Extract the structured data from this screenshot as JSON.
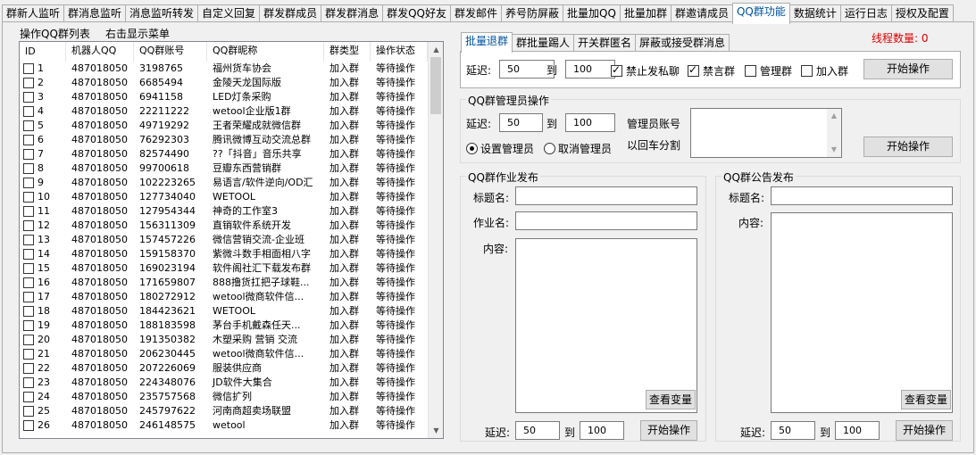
{
  "top_tabs": [
    "群新人监听",
    "群消息监听",
    "消息监听转发",
    "自定义回复",
    "群发群成员",
    "群发群消息",
    "群发QQ好友",
    "群发邮件",
    "养号防屏蔽",
    "批量加QQ",
    "批量加群",
    "群邀请成员",
    "QQ群功能",
    "数据统计",
    "运行日志",
    "授权及配置"
  ],
  "left": {
    "list_label": "操作QQ群列表",
    "menu_label": "右击显示菜单",
    "columns": [
      "ID",
      "机器人QQ",
      "QQ群账号",
      "QQ群昵称",
      "群类型",
      "操作状态"
    ],
    "rows": [
      [
        "1",
        "487018050",
        "3198765",
        "福州货车协会",
        "加入群",
        "等待操作"
      ],
      [
        "2",
        "487018050",
        "6685494",
        "金陵天龙国际版",
        "加入群",
        "等待操作"
      ],
      [
        "3",
        "487018050",
        "6941158",
        "LED灯条采购",
        "加入群",
        "等待操作"
      ],
      [
        "4",
        "487018050",
        "22211222",
        "wetool企业版1群",
        "加入群",
        "等待操作"
      ],
      [
        "5",
        "487018050",
        "49719292",
        "王者荣耀成就微信群",
        "加入群",
        "等待操作"
      ],
      [
        "6",
        "487018050",
        "76292303",
        "腾讯微博互动交流总群",
        "加入群",
        "等待操作"
      ],
      [
        "7",
        "487018050",
        "82574490",
        "??「抖音」音乐共享",
        "加入群",
        "等待操作"
      ],
      [
        "8",
        "487018050",
        "99700618",
        "豆瓣东西营销群",
        "加入群",
        "等待操作"
      ],
      [
        "9",
        "487018050",
        "102223265",
        "易语言/软件逆向/OD汇",
        "加入群",
        "等待操作"
      ],
      [
        "10",
        "487018050",
        "127734040",
        "WETOOL",
        "加入群",
        "等待操作"
      ],
      [
        "11",
        "487018050",
        "127954344",
        "神奇的工作室3",
        "加入群",
        "等待操作"
      ],
      [
        "12",
        "487018050",
        "156311309",
        "直销软件系统开发",
        "加入群",
        "等待操作"
      ],
      [
        "13",
        "487018050",
        "157457226",
        "微信营销交流-企业班",
        "加入群",
        "等待操作"
      ],
      [
        "14",
        "487018050",
        "159158370",
        "紫微斗数手相面相八字",
        "加入群",
        "等待操作"
      ],
      [
        "15",
        "487018050",
        "169023194",
        "软件阁社汇下载发布群",
        "加入群",
        "等待操作"
      ],
      [
        "16",
        "487018050",
        "171659807",
        "888撸货扛把子球鞋...",
        "加入群",
        "等待操作"
      ],
      [
        "17",
        "487018050",
        "180272912",
        "wetool微商软件信...",
        "加入群",
        "等待操作"
      ],
      [
        "18",
        "487018050",
        "184423621",
        "WETOOL",
        "加入群",
        "等待操作"
      ],
      [
        "19",
        "487018050",
        "188183598",
        "茅台手机戴森任天...",
        "加入群",
        "等待操作"
      ],
      [
        "20",
        "487018050",
        "191350382",
        "木塑采购 营销 交流",
        "加入群",
        "等待操作"
      ],
      [
        "21",
        "487018050",
        "206230445",
        "wetool微商软件信...",
        "加入群",
        "等待操作"
      ],
      [
        "22",
        "487018050",
        "207226069",
        "服装供应商",
        "加入群",
        "等待操作"
      ],
      [
        "23",
        "487018050",
        "224348076",
        "JD软件大集合",
        "加入群",
        "等待操作"
      ],
      [
        "24",
        "487018050",
        "235757568",
        "微信扩列",
        "加入群",
        "等待操作"
      ],
      [
        "25",
        "487018050",
        "245797622",
        "河南商超卖场联盟",
        "加入群",
        "等待操作"
      ],
      [
        "26",
        "487018050",
        "246148575",
        "wetool",
        "加入群",
        "等待操作"
      ]
    ]
  },
  "thread_count_label": "线程数量: 0",
  "sub_tabs": [
    "批量退群",
    "群批量踢人",
    "开关群匿名",
    "屏蔽或接受群消息"
  ],
  "batch_quit": {
    "delay_label": "延迟:",
    "delay_min": "50",
    "to_label": "到",
    "delay_max": "100",
    "chk_no_private": "禁止发私聊",
    "chk_mute": "禁言群",
    "chk_manage": "管理群",
    "chk_join": "加入群",
    "start_label": "开始操作"
  },
  "admin": {
    "title": "QQ群管理员操作",
    "delay_label": "延迟:",
    "delay_min": "50",
    "to_label": "到",
    "delay_max": "100",
    "account_label": "管理员账号",
    "split_label": "以回车分割",
    "radio_set": "设置管理员",
    "radio_cancel": "取消管理员",
    "start_label": "开始操作"
  },
  "homework": {
    "title": "QQ群作业发布",
    "title_label": "标题名:",
    "name_label": "作业名:",
    "content_label": "内容:",
    "vars_label": "查看变量",
    "delay_label": "延迟:",
    "delay_min": "50",
    "to_label": "到",
    "delay_max": "100",
    "start_label": "开始操作"
  },
  "notice": {
    "title": "QQ群公告发布",
    "title_label": "标题名:",
    "content_label": "内容:",
    "vars_label": "查看变量",
    "delay_label": "延迟:",
    "delay_min": "50",
    "to_label": "到",
    "delay_max": "100",
    "start_label": "开始操作"
  }
}
